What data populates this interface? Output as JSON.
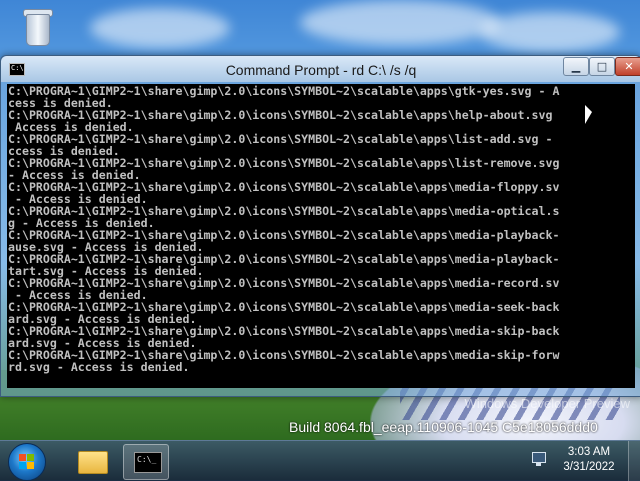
{
  "window": {
    "title": "Command Prompt - rd  C:\\ /s /q",
    "minimize_label": "▁",
    "maximize_label": "□",
    "close_label": "✕",
    "icon_text": "C:\\"
  },
  "console": {
    "lines": [
      "C:\\PROGRA~1\\GIMP2~1\\share\\gimp\\2.0\\icons\\SYMBOL~2\\scalable\\apps\\gtk-yes.svg - A",
      "cess is denied.",
      "C:\\PROGRA~1\\GIMP2~1\\share\\gimp\\2.0\\icons\\SYMBOL~2\\scalable\\apps\\help-about.svg",
      " Access is denied.",
      "C:\\PROGRA~1\\GIMP2~1\\share\\gimp\\2.0\\icons\\SYMBOL~2\\scalable\\apps\\list-add.svg -",
      "ccess is denied.",
      "C:\\PROGRA~1\\GIMP2~1\\share\\gimp\\2.0\\icons\\SYMBOL~2\\scalable\\apps\\list-remove.svg",
      "- Access is denied.",
      "C:\\PROGRA~1\\GIMP2~1\\share\\gimp\\2.0\\icons\\SYMBOL~2\\scalable\\apps\\media-floppy.sv",
      " - Access is denied.",
      "C:\\PROGRA~1\\GIMP2~1\\share\\gimp\\2.0\\icons\\SYMBOL~2\\scalable\\apps\\media-optical.s",
      "g - Access is denied.",
      "C:\\PROGRA~1\\GIMP2~1\\share\\gimp\\2.0\\icons\\SYMBOL~2\\scalable\\apps\\media-playback-",
      "ause.svg - Access is denied.",
      "C:\\PROGRA~1\\GIMP2~1\\share\\gimp\\2.0\\icons\\SYMBOL~2\\scalable\\apps\\media-playback-",
      "tart.svg - Access is denied.",
      "C:\\PROGRA~1\\GIMP2~1\\share\\gimp\\2.0\\icons\\SYMBOL~2\\scalable\\apps\\media-record.sv",
      " - Access is denied.",
      "C:\\PROGRA~1\\GIMP2~1\\share\\gimp\\2.0\\icons\\SYMBOL~2\\scalable\\apps\\media-seek-back",
      "ard.svg - Access is denied.",
      "C:\\PROGRA~1\\GIMP2~1\\share\\gimp\\2.0\\icons\\SYMBOL~2\\scalable\\apps\\media-skip-back",
      "ard.svg - Access is denied.",
      "C:\\PROGRA~1\\GIMP2~1\\share\\gimp\\2.0\\icons\\SYMBOL~2\\scalable\\apps\\media-skip-forw",
      "rd.svg - Access is denied."
    ]
  },
  "desktop": {
    "watermark_line1": "Windows Developer Preview",
    "watermark_line2": "Build 8064.fbl_eeap.110906-1045  C5e18056ddd0"
  },
  "taskbar": {
    "cmd_icon_text": "C:\\_",
    "clock_time": "3:03 AM",
    "clock_date": "3/31/2022"
  },
  "colors": {
    "console_bg": "#000000",
    "console_text": "#c0c0c0",
    "close_button": "#c0402a"
  }
}
